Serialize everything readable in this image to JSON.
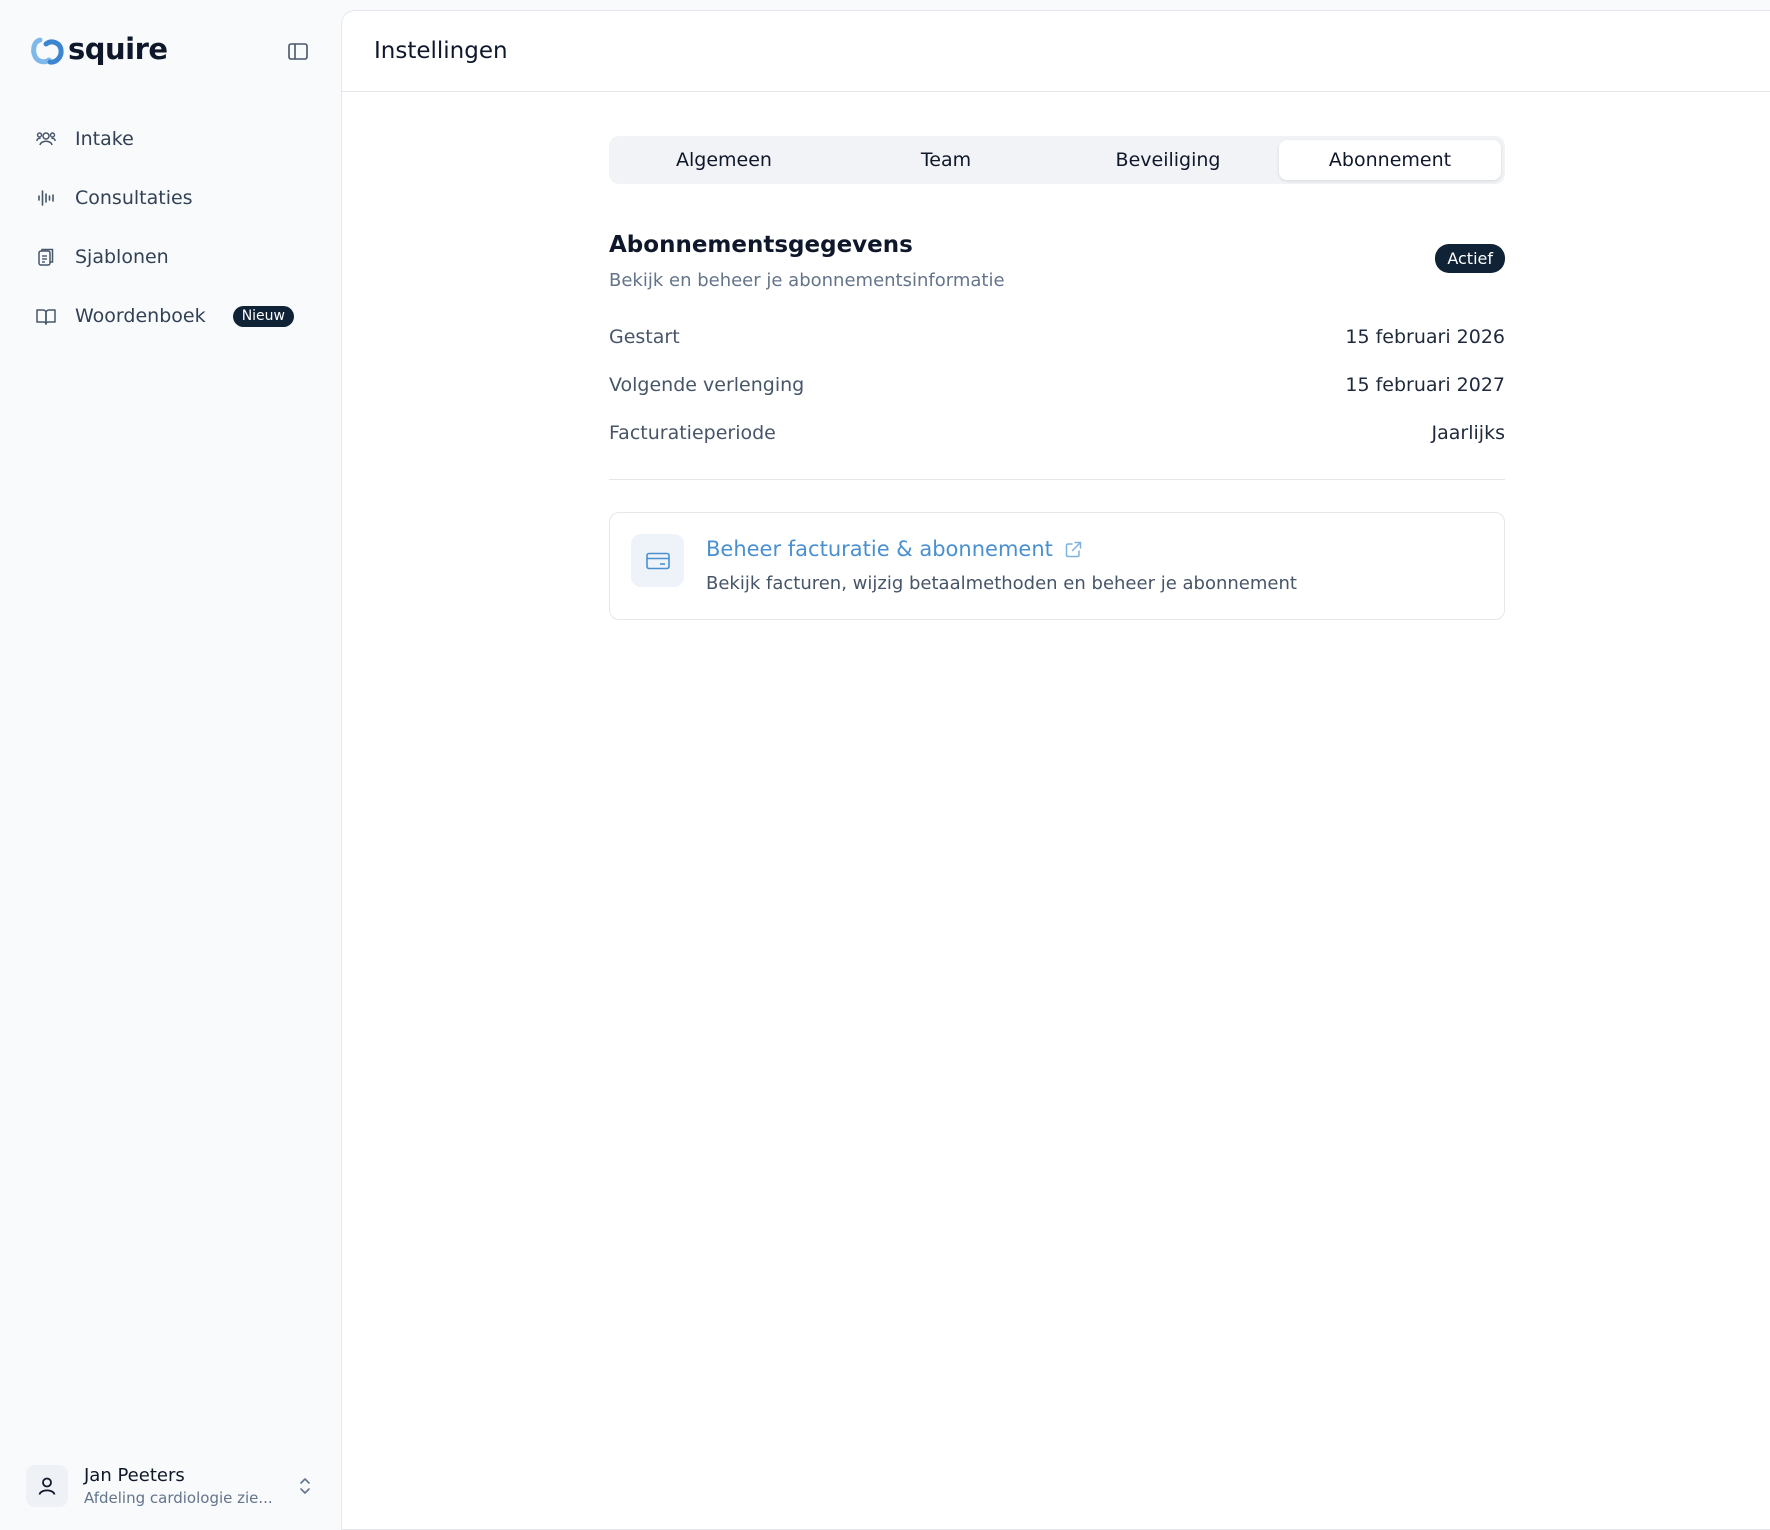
{
  "brand": {
    "name": "squire",
    "accent": "#4a90d0",
    "dark": "#0f2236"
  },
  "sidebar": {
    "collapse_icon": "panel-left-icon",
    "items": [
      {
        "label": "Intake",
        "icon": "users-icon"
      },
      {
        "label": "Consultaties",
        "icon": "audio-waveform-icon"
      },
      {
        "label": "Sjablonen",
        "icon": "clipboard-document-icon"
      },
      {
        "label": "Woordenboek",
        "icon": "book-open-icon",
        "badge": "Nieuw"
      }
    ],
    "user": {
      "name": "Jan Peeters",
      "organization": "Afdeling cardiologie zie..."
    }
  },
  "header": {
    "title": "Instellingen"
  },
  "tabs": [
    {
      "label": "Algemeen",
      "active": false
    },
    {
      "label": "Team",
      "active": false
    },
    {
      "label": "Beveiliging",
      "active": false
    },
    {
      "label": "Abonnement",
      "active": true
    }
  ],
  "subscription": {
    "title": "Abonnementsgegevens",
    "subtitle": "Bekijk en beheer je abonnementsinformatie",
    "status": "Actief",
    "rows": [
      {
        "label": "Gestart",
        "value": "15 februari 2026"
      },
      {
        "label": "Volgende verlenging",
        "value": "15 februari 2027"
      },
      {
        "label": "Facturatieperiode",
        "value": "Jaarlijks"
      }
    ]
  },
  "billing_card": {
    "title": "Beheer facturatie & abonnement",
    "description": "Bekijk facturen, wijzig betaalmethoden en beheer je abonnement",
    "icon": "credit-card-icon",
    "link_icon": "external-link-icon"
  }
}
